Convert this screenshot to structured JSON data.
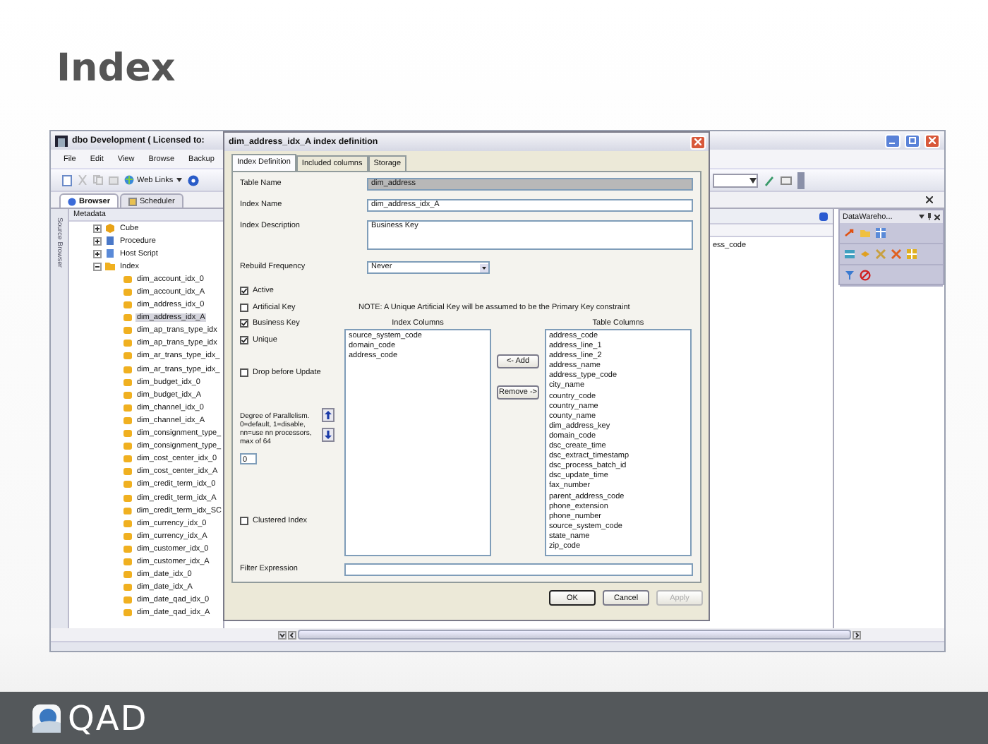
{
  "slide": {
    "title": "Index",
    "logo_text": "QAD"
  },
  "app": {
    "title": "dbo Development ( Licensed to:",
    "menu": [
      "File",
      "Edit",
      "View",
      "Browse",
      "Backup"
    ],
    "web_links": "Web Links",
    "tabs": [
      {
        "label": "Browser",
        "selected": true
      },
      {
        "label": "Scheduler",
        "selected": false
      }
    ],
    "side_strip": "Source Browser",
    "tree": {
      "header": "Metadata",
      "items": [
        {
          "label": "Cube",
          "kind": "cube",
          "expanded": false
        },
        {
          "label": "Procedure",
          "kind": "procedure",
          "expanded": false
        },
        {
          "label": "Host Script",
          "kind": "script",
          "expanded": false
        },
        {
          "label": "Index",
          "kind": "folder",
          "expanded": true,
          "children": [
            {
              "label": "dim_account_idx_0",
              "selected": false
            },
            {
              "label": "dim_account_idx_A",
              "selected": false
            },
            {
              "label": "dim_address_idx_0",
              "selected": false
            },
            {
              "label": "dim_address_idx_A",
              "selected": true
            },
            {
              "label": "dim_ap_trans_type_idx",
              "selected": false
            },
            {
              "label": "dim_ap_trans_type_idx",
              "selected": false
            },
            {
              "label": "dim_ar_trans_type_idx_",
              "selected": false
            },
            {
              "label": "dim_ar_trans_type_idx_",
              "selected": false
            },
            {
              "label": "dim_budget_idx_0",
              "selected": false
            },
            {
              "label": "dim_budget_idx_A",
              "selected": false
            },
            {
              "label": "dim_channel_idx_0",
              "selected": false
            },
            {
              "label": "dim_channel_idx_A",
              "selected": false
            },
            {
              "label": "dim_consignment_type_",
              "selected": false
            },
            {
              "label": "dim_consignment_type_",
              "selected": false
            },
            {
              "label": "dim_cost_center_idx_0",
              "selected": false
            },
            {
              "label": "dim_cost_center_idx_A",
              "selected": false
            },
            {
              "label": "dim_credit_term_idx_0",
              "selected": false
            },
            {
              "label": "dim_credit_term_idx_A",
              "selected": false
            },
            {
              "label": "dim_credit_term_idx_SC",
              "selected": false
            },
            {
              "label": "dim_currency_idx_0",
              "selected": false
            },
            {
              "label": "dim_currency_idx_A",
              "selected": false
            },
            {
              "label": "dim_customer_idx_0",
              "selected": false
            },
            {
              "label": "dim_customer_idx_A",
              "selected": false
            },
            {
              "label": "dim_date_idx_0",
              "selected": false
            },
            {
              "label": "dim_date_idx_A",
              "selected": false
            },
            {
              "label": "dim_date_qad_idx_0",
              "selected": false
            },
            {
              "label": "dim_date_qad_idx_A",
              "selected": false
            }
          ]
        }
      ]
    },
    "content_fragment": "ess_code",
    "dock_panel": {
      "title": "DataWareho..."
    }
  },
  "dialog": {
    "title": "dim_address_idx_A index definition",
    "tabs": [
      {
        "label": "Index Definition",
        "selected": true
      },
      {
        "label": "Included columns",
        "selected": false
      },
      {
        "label": "Storage",
        "selected": false
      }
    ],
    "fields": [
      {
        "label": "Table Name",
        "value": "dim_address",
        "kind": "text",
        "readonly": true
      },
      {
        "label": "Index Name",
        "value": "dim_address_idx_A",
        "kind": "text",
        "readonly": false
      },
      {
        "label": "Index Description",
        "value": "Business Key",
        "kind": "textarea",
        "readonly": false
      },
      {
        "label": "Rebuild Frequency",
        "value": "Never",
        "kind": "select",
        "readonly": false
      }
    ],
    "options": [
      {
        "label": "Active",
        "checked": true
      },
      {
        "label": "Artificial Key",
        "checked": false
      },
      {
        "label": "Business Key",
        "checked": true
      },
      {
        "label": "Unique",
        "checked": true
      }
    ],
    "drop_before_update": {
      "label": "Drop before Update",
      "checked": false
    },
    "parallelism": {
      "label": "Degree of Parallelism. 0=default, 1=disable, nn=use nn processors, max of 64",
      "value": "0"
    },
    "clustered": {
      "label": "Clustered Index",
      "checked": false
    },
    "note": "NOTE: A Unique Artificial Key will be assumed to be the  Primary Key constraint",
    "index_columns": {
      "header": "Index Columns",
      "items": [
        "source_system_code",
        "domain_code",
        "address_code"
      ]
    },
    "table_columns": {
      "header": "Table Columns",
      "items": [
        "address_code",
        "address_line_1",
        "address_line_2",
        "address_name",
        "address_type_code",
        "city_name",
        "country_code",
        "country_name",
        "county_name",
        "dim_address_key",
        "domain_code",
        "dsc_create_time",
        "dsc_extract_timestamp",
        "dsc_process_batch_id",
        "dsc_update_time",
        "fax_number",
        "parent_address_code",
        "phone_extension",
        "phone_number",
        "source_system_code",
        "state_name",
        "zip_code"
      ]
    },
    "add_button": "<- Add",
    "remove_button": "Remove ->",
    "filter": {
      "label": "Filter Expression"
    },
    "buttons": [
      {
        "label": "OK",
        "disabled": false
      },
      {
        "label": "Cancel",
        "disabled": false
      },
      {
        "label": "Apply",
        "disabled": true
      }
    ]
  }
}
